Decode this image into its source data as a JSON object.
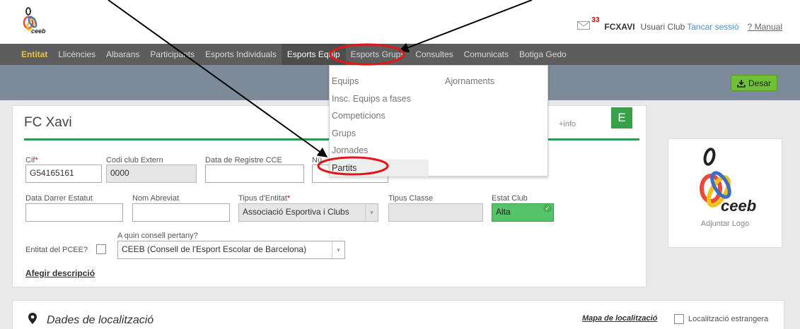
{
  "header": {
    "logo_text": "ceeb",
    "mail_count": "33",
    "user": "FCXAVI",
    "role": "Usuari Club",
    "logout": "Tancar sessió",
    "manual": "? Manual"
  },
  "nav": [
    {
      "label": "Entitat"
    },
    {
      "label": "Llicències"
    },
    {
      "label": "Albarans"
    },
    {
      "label": "Participants"
    },
    {
      "label": "Esports Individuals"
    },
    {
      "label": "Esports Equip"
    },
    {
      "label": "Esports Grups"
    },
    {
      "label": "Consultes"
    },
    {
      "label": "Comunicats"
    },
    {
      "label": "Botiga Gedo"
    }
  ],
  "toolbar": {
    "save": "Desar"
  },
  "dropdown": {
    "col1": [
      "Equips",
      "Insc. Equips a fases",
      "Competicions",
      "Grups",
      "Jornades",
      "Partits"
    ],
    "col2": [
      "Ajornaments"
    ]
  },
  "entity": {
    "title": "FC Xavi",
    "info": "+info",
    "badge": "E",
    "fields": {
      "cif_label": "Cif",
      "cif_value": "G54165161",
      "codi_label": "Codi club Extern",
      "codi_value": "0000",
      "data_reg_label": "Data de Registre CCE",
      "num_label": "Nú",
      "data_estatut_label": "Data Darrer Estatut",
      "nom_abreviat_label": "Nom Abreviat",
      "tipus_entitat_label": "Tipus d'Entitat",
      "tipus_entitat_value": "Associació Esportiva i Clubs",
      "tipus_classe_label": "Tipus Classe",
      "estat_label": "Estat Club",
      "estat_value": "Alta",
      "consell_label": "A quin consell pertany?",
      "consell_value": "CEEB (Consell de l'Esport Escolar de Barcelona)",
      "pcee_label": "Entitat del PCEE?",
      "desc_link": "Afegir descripció"
    }
  },
  "logo_box": {
    "logo_text": "ceeb",
    "adjuntar": "Adjuntar Logo"
  },
  "location": {
    "title": "Dades de localització",
    "map_link": "Mapa de localització",
    "foreign": "Localització estrangera"
  }
}
